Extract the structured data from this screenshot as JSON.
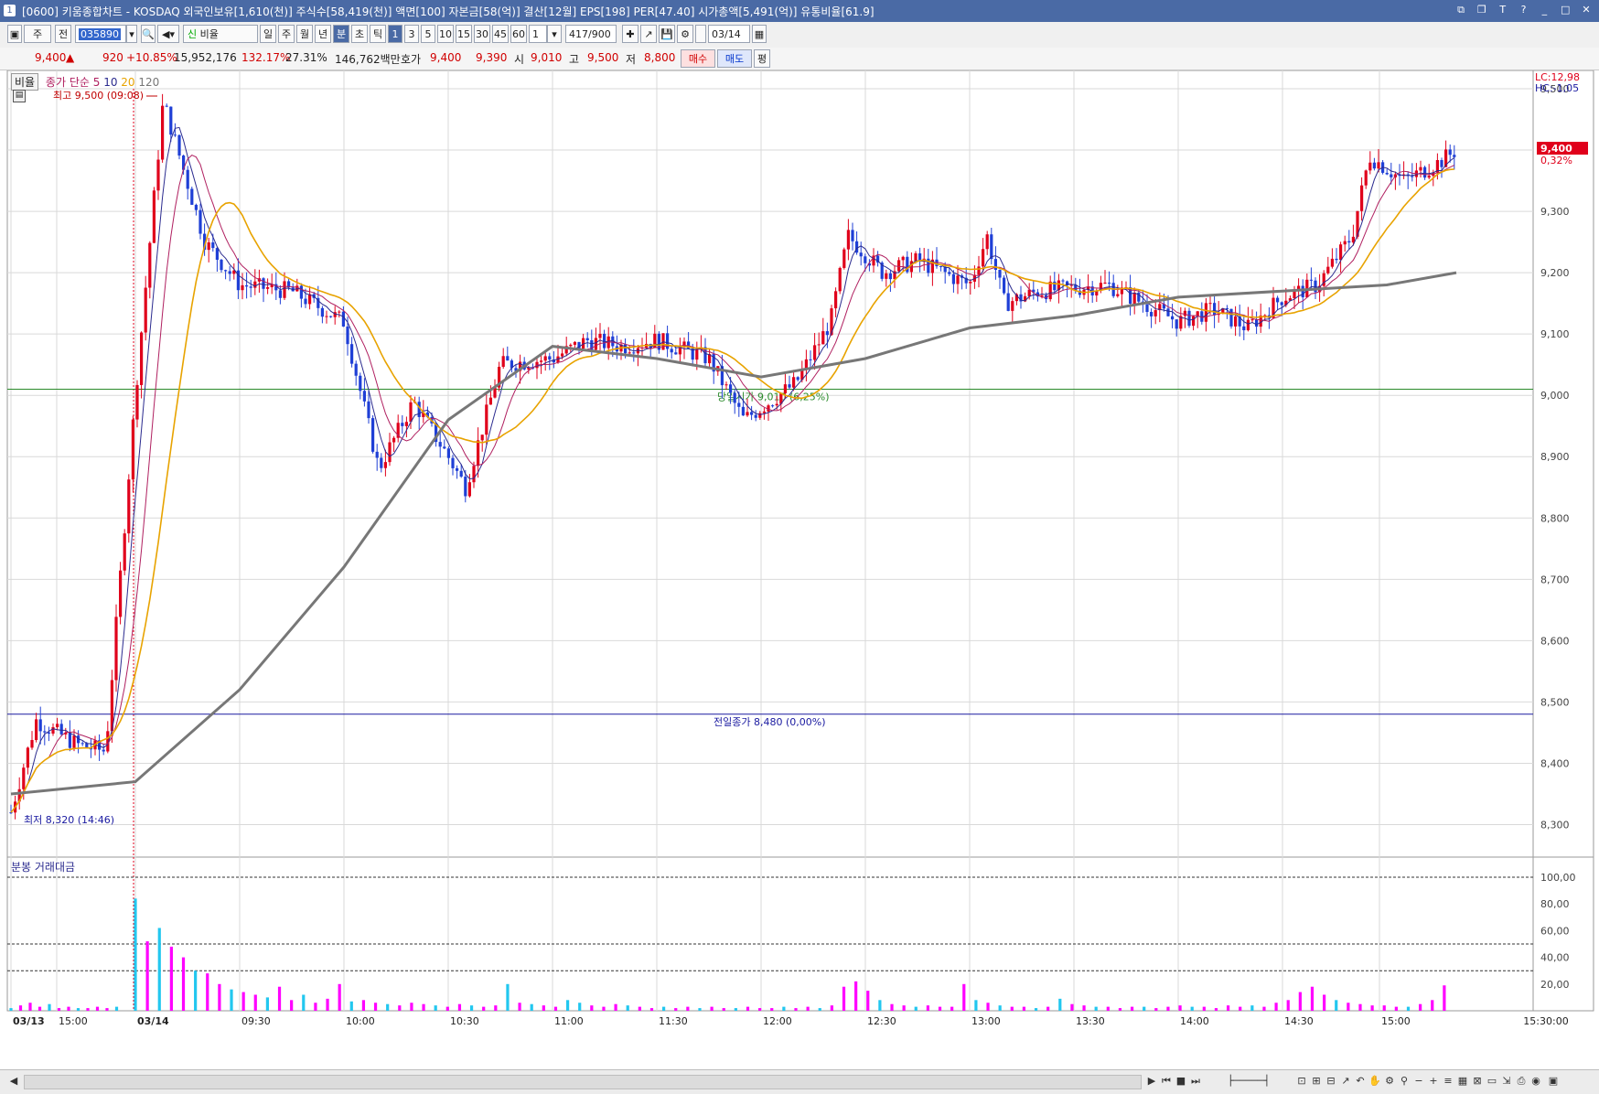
{
  "window": {
    "title": "[0600] 키움종합차트 - KOSDAQ 외국인보유[1,610(천)] 주식수[58,419(천)] 액면[100] 자본금[58(억)] 결산[12월] EPS[198] PER[47.40] 시가총액[5,491(억)] 유통비율[61.9]",
    "icon_label": "1"
  },
  "toolbar": {
    "market": "주",
    "prefix": "전",
    "code": "035890",
    "compare_label": "비율",
    "periods": [
      "일",
      "주",
      "월",
      "년",
      "분",
      "초",
      "틱"
    ],
    "selected_period": "분",
    "intervals": [
      "1",
      "3",
      "5",
      "10",
      "15",
      "30",
      "45",
      "60"
    ],
    "selected_interval": "1",
    "interval_value": "1",
    "count": "417/900",
    "date": "03/14"
  },
  "quote": {
    "price": "9,400",
    "arrow": "▲",
    "change": "920",
    "change_pct": "+10.85%",
    "volume": "15,952,176",
    "volume_ratio": "132.17%",
    "turnover": "27.31%",
    "amount": "146,762백만",
    "bid_label": "호가",
    "bid1": "9,400",
    "bid2": "9,390",
    "open_label": "시",
    "open": "9,010",
    "high_label": "고",
    "high": "9,500",
    "low_label": "저",
    "low": "8,800",
    "buy_label": "매수",
    "sell_label": "매도",
    "avg_label": "평"
  },
  "legend": {
    "chip": "비율",
    "ma_label": "종가 단순 5",
    "ma_periods": [
      "10",
      "20",
      "120"
    ],
    "volume_label": "분봉 거래대금"
  },
  "annotations": {
    "high": "최고 9,500 (09:08)",
    "low": "최저 8,320 (14:46)",
    "open_line": "당일시가 9,010 (6,25%)",
    "prev_close": "전일종가 8,480 (0,00%)",
    "lc": "LC:12,98",
    "hc": "HC:-1,05",
    "last_price": "9,400",
    "last_pct": "0,32%"
  },
  "colors": {
    "up": "#e0001b",
    "down": "#1f3fd6",
    "ma5": "#2b2b8f",
    "ma10": "#b02060",
    "ma20": "#e8a300",
    "ma120": "#777777",
    "vol_up": "#ff00ff",
    "vol_down": "#22c7ef",
    "grid": "#d9d9d9",
    "open_line": "#2a8a2a",
    "prev_close_line": "#1a1aa0"
  },
  "chart_data": [
    {
      "type": "candlestick",
      "title": "",
      "price_axis": {
        "min": 8250,
        "max": 9500,
        "ticks": [
          "9,500",
          "9,400",
          "9,300",
          "9,200",
          "9,100",
          "9,000",
          "8,900",
          "8,800",
          "8,700",
          "8,600",
          "8,500",
          "8,400",
          "8,300"
        ]
      },
      "x_ticks": [
        "03/13",
        "15:00",
        "03/14",
        "09:30",
        "10:00",
        "10:30",
        "11:00",
        "11:30",
        "12:00",
        "12:30",
        "13:00",
        "13:30",
        "14:00",
        "14:30",
        "15:00",
        "15:30:00"
      ],
      "reference_lines": {
        "open": 9010,
        "prev_close": 8480
      },
      "high": {
        "time": "09:08",
        "value": 9500
      },
      "low": {
        "time": "14:46",
        "value": 8320
      },
      "close_path": [
        [
          "03/13 14:46",
          8320
        ],
        [
          "03/13 14:55",
          8470
        ],
        [
          "03/13 15:10",
          8430
        ],
        [
          "03/13 15:20",
          8420
        ],
        [
          "03/14 09:00",
          9000
        ],
        [
          "03/14 09:08",
          9480
        ],
        [
          "03/14 09:20",
          9250
        ],
        [
          "03/14 09:30",
          9180
        ],
        [
          "03/14 09:45",
          9170
        ],
        [
          "03/14 10:00",
          9120
        ],
        [
          "03/14 10:10",
          8880
        ],
        [
          "03/14 10:20",
          8990
        ],
        [
          "03/14 10:30",
          8900
        ],
        [
          "03/14 10:35",
          8850
        ],
        [
          "03/14 10:45",
          9050
        ],
        [
          "03/14 11:00",
          9060
        ],
        [
          "03/14 11:10",
          9090
        ],
        [
          "03/14 11:20",
          9080
        ],
        [
          "03/14 11:30",
          9090
        ],
        [
          "03/14 11:45",
          9060
        ],
        [
          "03/14 11:55",
          8960
        ],
        [
          "03/14 12:10",
          9020
        ],
        [
          "03/14 12:20",
          9120
        ],
        [
          "03/14 12:25",
          9260
        ],
        [
          "03/14 12:35",
          9200
        ],
        [
          "03/14 12:45",
          9220
        ],
        [
          "03/14 13:00",
          9180
        ],
        [
          "03/14 13:05",
          9260
        ],
        [
          "03/14 13:10",
          9150
        ],
        [
          "03/14 13:20",
          9170
        ],
        [
          "03/14 13:40",
          9180
        ],
        [
          "03/14 13:50",
          9150
        ],
        [
          "03/14 14:00",
          9120
        ],
        [
          "03/14 14:10",
          9140
        ],
        [
          "03/14 14:20",
          9110
        ],
        [
          "03/14 14:30",
          9160
        ],
        [
          "03/14 14:40",
          9180
        ],
        [
          "03/14 14:50",
          9260
        ],
        [
          "03/14 14:55",
          9390
        ],
        [
          "03/14 15:05",
          9350
        ],
        [
          "03/14 15:15",
          9380
        ],
        [
          "03/14 15:20",
          9400
        ]
      ],
      "ma120_path": [
        [
          "03/13 14:46",
          8350
        ],
        [
          "03/14 09:00",
          8370
        ],
        [
          "03/14 09:30",
          8520
        ],
        [
          "03/14 10:00",
          8720
        ],
        [
          "03/14 10:30",
          8960
        ],
        [
          "03/14 11:00",
          9080
        ],
        [
          "03/14 11:30",
          9060
        ],
        [
          "03/14 12:00",
          9030
        ],
        [
          "03/14 12:30",
          9060
        ],
        [
          "03/14 13:00",
          9110
        ],
        [
          "03/14 13:30",
          9130
        ],
        [
          "03/14 14:00",
          9160
        ],
        [
          "03/14 14:30",
          9170
        ],
        [
          "03/14 15:00",
          9180
        ],
        [
          "03/14 15:20",
          9200
        ]
      ]
    },
    {
      "type": "bar",
      "title": "분봉 거래대금",
      "y_ticks": [
        "100,00",
        "80,00",
        "60,00",
        "40,00",
        "20,00"
      ],
      "ylim": [
        0,
        100
      ],
      "reference_levels": [
        100,
        50,
        30
      ],
      "values": [
        [
          2,
          "down"
        ],
        [
          4,
          "up"
        ],
        [
          6,
          "up"
        ],
        [
          3,
          "up"
        ],
        [
          5,
          "down"
        ],
        [
          2,
          "up"
        ],
        [
          3,
          "up"
        ],
        [
          2,
          "down"
        ],
        [
          2,
          "up"
        ],
        [
          3,
          "up"
        ],
        [
          2,
          "up"
        ],
        [
          3,
          "down"
        ],
        [
          84,
          "down"
        ],
        [
          52,
          "up"
        ],
        [
          62,
          "down"
        ],
        [
          48,
          "up"
        ],
        [
          40,
          "up"
        ],
        [
          30,
          "down"
        ],
        [
          28,
          "up"
        ],
        [
          20,
          "up"
        ],
        [
          16,
          "down"
        ],
        [
          14,
          "up"
        ],
        [
          12,
          "up"
        ],
        [
          10,
          "down"
        ],
        [
          18,
          "up"
        ],
        [
          8,
          "up"
        ],
        [
          12,
          "down"
        ],
        [
          6,
          "up"
        ],
        [
          9,
          "up"
        ],
        [
          20,
          "up"
        ],
        [
          7,
          "down"
        ],
        [
          8,
          "up"
        ],
        [
          6,
          "up"
        ],
        [
          5,
          "down"
        ],
        [
          4,
          "up"
        ],
        [
          6,
          "up"
        ],
        [
          5,
          "up"
        ],
        [
          4,
          "down"
        ],
        [
          3,
          "up"
        ],
        [
          5,
          "up"
        ],
        [
          4,
          "down"
        ],
        [
          3,
          "up"
        ],
        [
          4,
          "up"
        ],
        [
          20,
          "down"
        ],
        [
          6,
          "up"
        ],
        [
          5,
          "down"
        ],
        [
          4,
          "up"
        ],
        [
          3,
          "up"
        ],
        [
          8,
          "down"
        ],
        [
          6,
          "down"
        ],
        [
          4,
          "up"
        ],
        [
          3,
          "up"
        ],
        [
          5,
          "up"
        ],
        [
          4,
          "down"
        ],
        [
          3,
          "up"
        ],
        [
          2,
          "up"
        ],
        [
          3,
          "down"
        ],
        [
          2,
          "up"
        ],
        [
          3,
          "up"
        ],
        [
          2,
          "down"
        ],
        [
          3,
          "up"
        ],
        [
          2,
          "up"
        ],
        [
          2,
          "down"
        ],
        [
          3,
          "up"
        ],
        [
          2,
          "up"
        ],
        [
          2,
          "up"
        ],
        [
          3,
          "down"
        ],
        [
          2,
          "up"
        ],
        [
          3,
          "up"
        ],
        [
          2,
          "down"
        ],
        [
          4,
          "up"
        ],
        [
          18,
          "up"
        ],
        [
          22,
          "up"
        ],
        [
          15,
          "up"
        ],
        [
          8,
          "down"
        ],
        [
          5,
          "up"
        ],
        [
          4,
          "up"
        ],
        [
          3,
          "down"
        ],
        [
          4,
          "up"
        ],
        [
          3,
          "up"
        ],
        [
          3,
          "up"
        ],
        [
          20,
          "up"
        ],
        [
          8,
          "down"
        ],
        [
          6,
          "up"
        ],
        [
          4,
          "down"
        ],
        [
          3,
          "up"
        ],
        [
          3,
          "up"
        ],
        [
          2,
          "down"
        ],
        [
          3,
          "up"
        ],
        [
          9,
          "down"
        ],
        [
          5,
          "up"
        ],
        [
          4,
          "up"
        ],
        [
          3,
          "down"
        ],
        [
          3,
          "up"
        ],
        [
          2,
          "up"
        ],
        [
          3,
          "up"
        ],
        [
          3,
          "down"
        ],
        [
          2,
          "up"
        ],
        [
          3,
          "up"
        ],
        [
          4,
          "up"
        ],
        [
          3,
          "down"
        ],
        [
          3,
          "up"
        ],
        [
          2,
          "up"
        ],
        [
          4,
          "up"
        ],
        [
          3,
          "up"
        ],
        [
          4,
          "down"
        ],
        [
          3,
          "up"
        ],
        [
          6,
          "up"
        ],
        [
          8,
          "up"
        ],
        [
          14,
          "up"
        ],
        [
          18,
          "up"
        ],
        [
          12,
          "up"
        ],
        [
          8,
          "down"
        ],
        [
          6,
          "up"
        ],
        [
          5,
          "up"
        ],
        [
          4,
          "up"
        ],
        [
          4,
          "up"
        ],
        [
          3,
          "up"
        ],
        [
          3,
          "down"
        ],
        [
          5,
          "up"
        ],
        [
          8,
          "up"
        ],
        [
          19,
          "up"
        ]
      ]
    }
  ]
}
